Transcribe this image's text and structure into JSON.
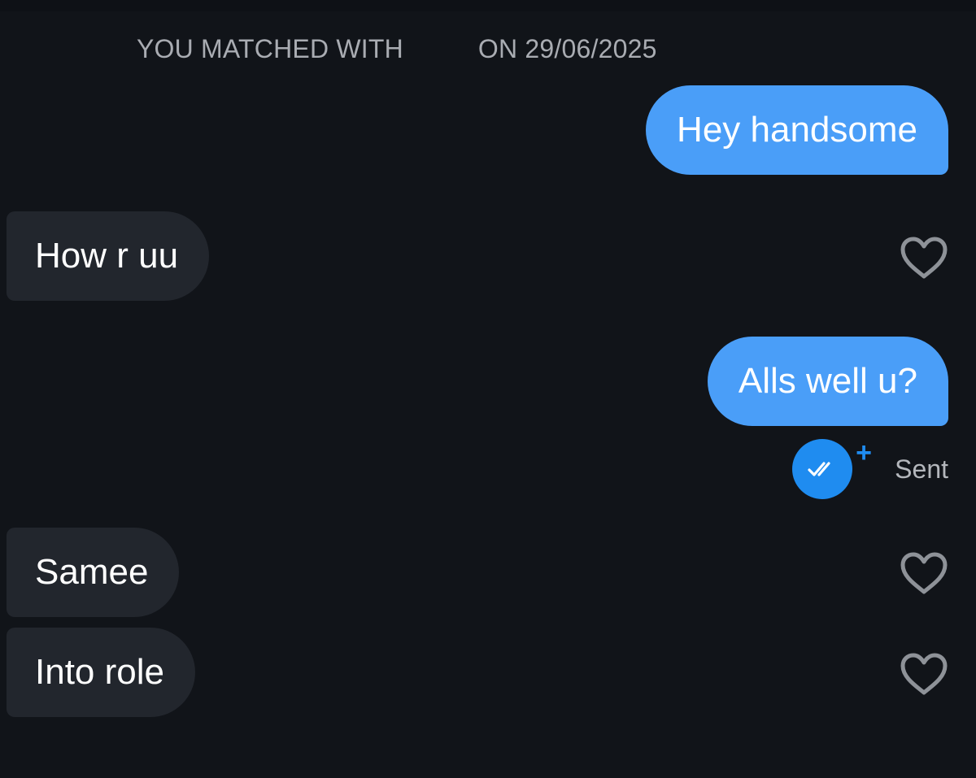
{
  "header": {
    "match_prefix": "YOU MATCHED WITH",
    "match_date": "ON 29/06/2025"
  },
  "messages": [
    {
      "direction": "outgoing",
      "text": "Hey handsome"
    },
    {
      "direction": "incoming",
      "text": "How r uu"
    },
    {
      "direction": "outgoing",
      "text": "Alls well u?"
    },
    {
      "direction": "incoming",
      "text": "Samee"
    },
    {
      "direction": "incoming",
      "text": "Into role"
    }
  ],
  "status": {
    "label": "Sent",
    "read_icon": "double-check-icon",
    "extra_icon": "plus-icon",
    "plus_glyph": "+"
  },
  "icons": {
    "like": "heart-outline-icon"
  },
  "colors": {
    "background": "#111419",
    "outgoing_bubble": "#4a9ef8",
    "incoming_bubble": "#22262d",
    "accent": "#1f8cf0",
    "muted_text": "#a9acb2"
  }
}
